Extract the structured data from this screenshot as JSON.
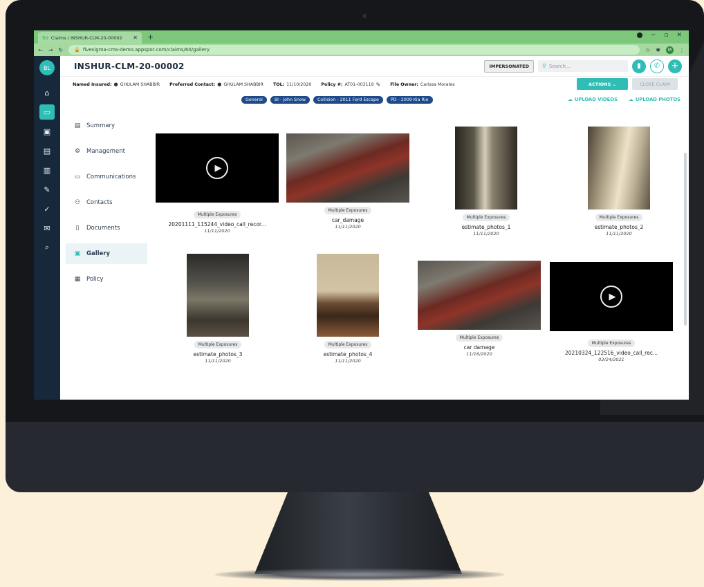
{
  "browser": {
    "tab_title": "Claims / INSHUR-CLM-20-00002",
    "url": "fivesigma-cms-demo.appspot.com/claims/60/gallery",
    "profile_initial": "M"
  },
  "rail": {
    "avatar": "BL"
  },
  "header": {
    "claim_id": "INSHUR-CLM-20-00002",
    "impersonated": "IMPERSONATED",
    "search_placeholder": "Search..."
  },
  "info": {
    "named_insured_label": "Named Insured:",
    "named_insured": "GHULAM SHABBIR",
    "preferred_contact_label": "Preferred Contact:",
    "preferred_contact": "GHULAM SHABBIR",
    "tol_label": "TOL:",
    "tol": "11/10/2020",
    "policy_label": "Policy #:",
    "policy": "AT01-003119",
    "owner_label": "File Owner:",
    "owner": "Carissa Morales"
  },
  "buttons": {
    "actions": "ACTIONS",
    "close_claim": "CLOSE CLAIM",
    "upload_videos": "UPLOAD VIDEOS",
    "upload_photos": "UPLOAD PHOTOS"
  },
  "filters": [
    "General",
    "BI - John Snow",
    "Collision - 2011 Ford Escape",
    "PD - 2009 Kia Rio"
  ],
  "nav": [
    {
      "label": "Summary",
      "icon": "clipboard-icon"
    },
    {
      "label": "Management",
      "icon": "gear-icon"
    },
    {
      "label": "Communications",
      "icon": "chat-icon"
    },
    {
      "label": "Contacts",
      "icon": "people-icon"
    },
    {
      "label": "Documents",
      "icon": "document-icon"
    },
    {
      "label": "Gallery",
      "icon": "gallery-icon",
      "active": true
    },
    {
      "label": "Policy",
      "icon": "policy-icon"
    }
  ],
  "gallery": [
    {
      "type": "video",
      "badge": "Multiple Exposures",
      "name": "20201111_115244_video_call_recor...",
      "date": "11/11/2020"
    },
    {
      "type": "photo",
      "badge": "Multiple Exposures",
      "name": "car_damage",
      "date": "11/11/2020"
    },
    {
      "type": "photo",
      "badge": "Multiple Exposures",
      "name": "estimate_photos_1",
      "date": "11/11/2020"
    },
    {
      "type": "photo",
      "badge": "Multiple Exposures",
      "name": "estimate_photos_2",
      "date": "11/11/2020"
    },
    {
      "type": "photo",
      "badge": "Multiple Exposures",
      "name": "estimate_photos_3",
      "date": "11/11/2020"
    },
    {
      "type": "photo",
      "badge": "Multiple Exposures",
      "name": "estimate_photos_4",
      "date": "11/11/2020"
    },
    {
      "type": "photo",
      "badge": "Multiple Exposures",
      "name": "car damage",
      "date": "11/16/2020"
    },
    {
      "type": "video",
      "badge": "Multiple Exposures",
      "name": "20210324_122516_video_call_rec...",
      "date": "03/24/2021"
    }
  ],
  "colors": {
    "accent": "#2fbdb5",
    "rail": "#17283a",
    "chip": "#1d4a8a",
    "browser_green": "#7cc77a"
  }
}
